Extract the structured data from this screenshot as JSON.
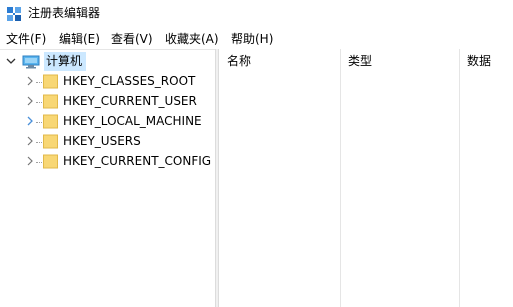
{
  "window": {
    "title": "注册表编辑器",
    "icon": "regedit-icon"
  },
  "menu": [
    {
      "label": "文件(F)"
    },
    {
      "label": "编辑(E)"
    },
    {
      "label": "查看(V)"
    },
    {
      "label": "收藏夹(A)"
    },
    {
      "label": "帮助(H)"
    }
  ],
  "tree": {
    "root": {
      "label": "计算机",
      "icon": "computer-icon",
      "expanded": true,
      "selected": true
    },
    "children": [
      {
        "label": "HKEY_CLASSES_ROOT",
        "icon": "folder-icon",
        "expanded": false
      },
      {
        "label": "HKEY_CURRENT_USER",
        "icon": "folder-icon",
        "expanded": false
      },
      {
        "label": "HKEY_LOCAL_MACHINE",
        "icon": "folder-icon",
        "expanded": false
      },
      {
        "label": "HKEY_USERS",
        "icon": "folder-icon",
        "expanded": false
      },
      {
        "label": "HKEY_CURRENT_CONFIG",
        "icon": "folder-icon",
        "expanded": false
      }
    ]
  },
  "list": {
    "columns": [
      {
        "label": "名称"
      },
      {
        "label": "类型"
      },
      {
        "label": "数据"
      }
    ],
    "rows": []
  },
  "colors": {
    "folder": "#f8d775",
    "selection": "#cce8ff",
    "expander": "#4a90d9"
  }
}
